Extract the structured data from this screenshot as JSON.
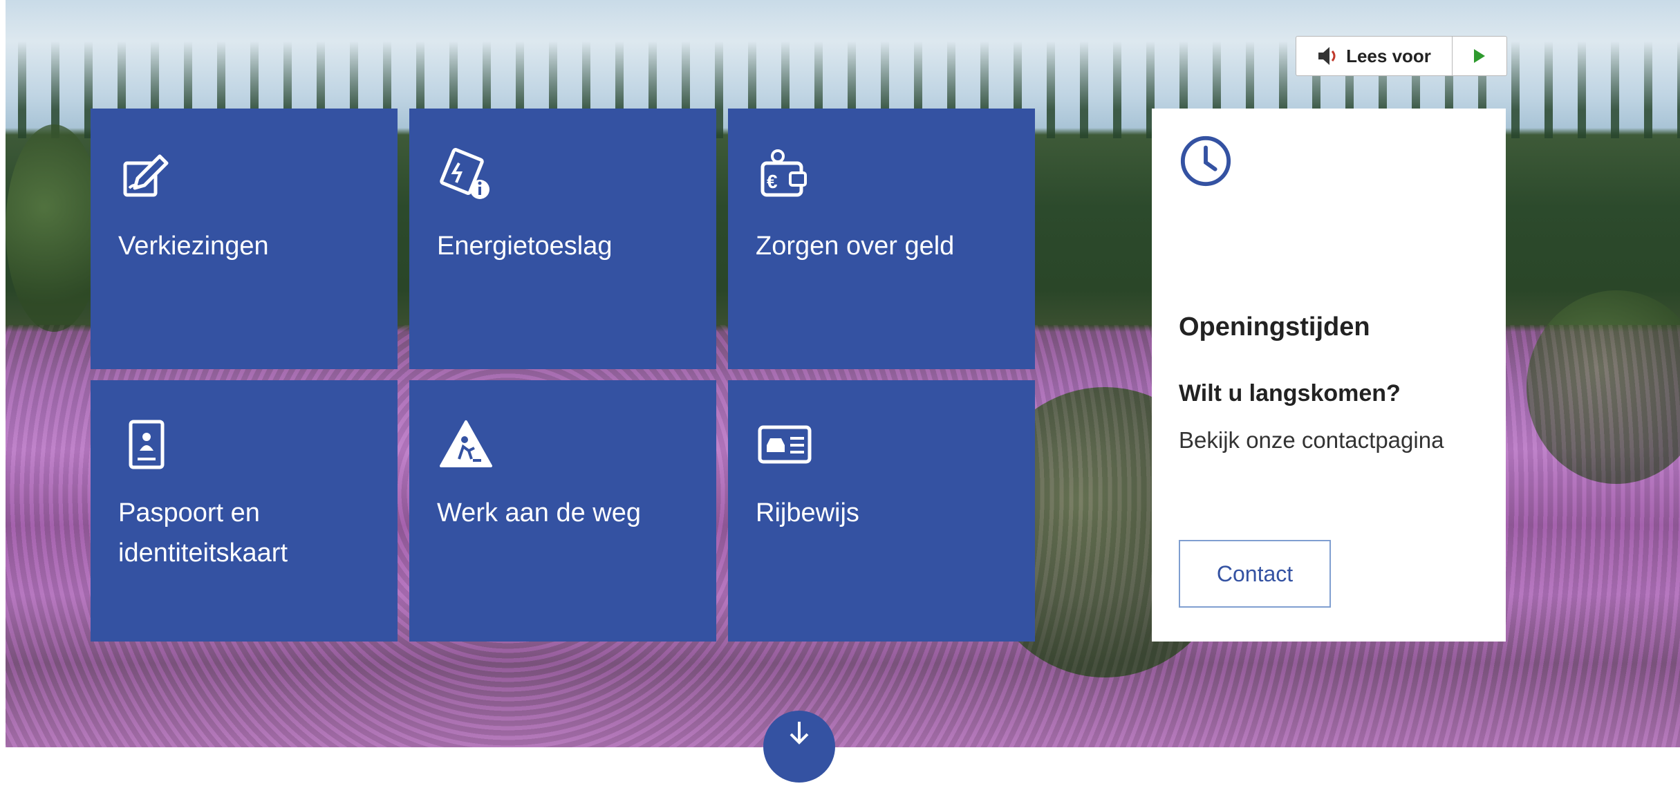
{
  "tts": {
    "label": "Lees voor",
    "speaker_icon": "speaker-icon",
    "play_icon": "play-icon"
  },
  "tiles": [
    {
      "label": "Verkiezingen",
      "icon": "ballot-pen-icon"
    },
    {
      "label": "Energietoeslag",
      "icon": "energy-bill-info-icon"
    },
    {
      "label": "Zorgen over geld",
      "icon": "euro-wallet-icon"
    },
    {
      "label": "Paspoort en identiteitskaart",
      "icon": "passport-icon"
    },
    {
      "label": "Werk aan de weg",
      "icon": "road-works-icon"
    },
    {
      "label": "Rijbewijs",
      "icon": "drivers-license-icon"
    }
  ],
  "openingstijden": {
    "title": "Openingstijden",
    "subtitle": "Wilt u langskomen?",
    "text": "Bekijk onze contactpagina",
    "button": "Contact",
    "icon": "clock-icon"
  },
  "scroll_icon": "arrow-down-icon",
  "colors": {
    "tile_blue": "#3452a2",
    "button_border": "#7f9ed0",
    "play_green": "#2e9a2e"
  }
}
